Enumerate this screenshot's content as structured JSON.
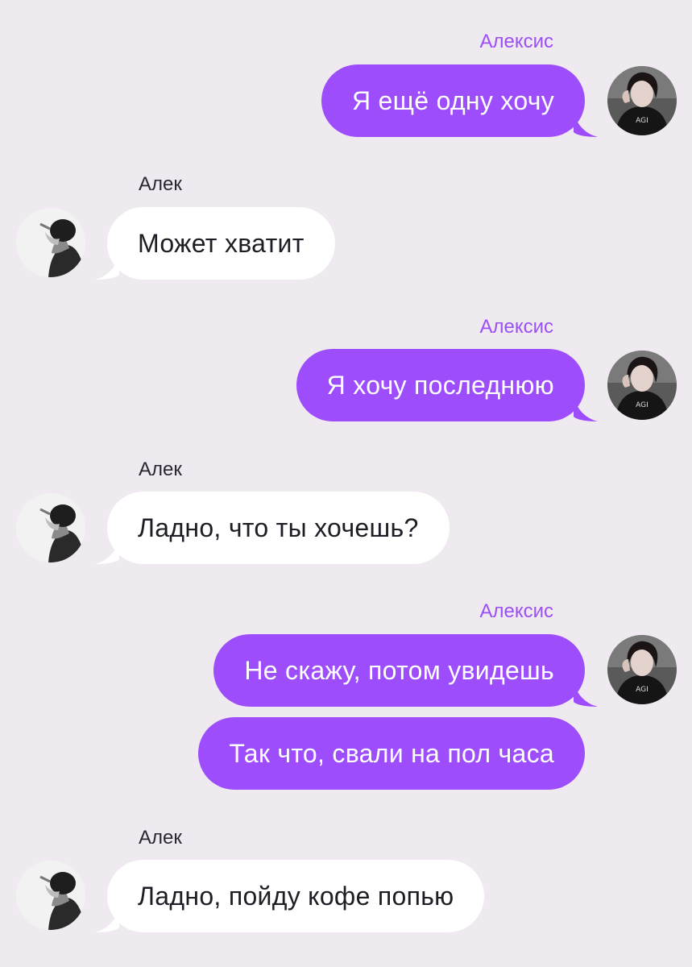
{
  "messages": [
    {
      "sender": "Алексис",
      "text": "Я ещё одну хочу"
    },
    {
      "sender": "Алек",
      "text": "Может хватит"
    },
    {
      "sender": "Алексис",
      "text": "Я хочу последнюю"
    },
    {
      "sender": "Алек",
      "text": "Ладно, что ты хочешь?"
    },
    {
      "sender": "Алексис",
      "text": "Не скажу, потом увидешь"
    },
    {
      "sender": "Алексис",
      "text": "Так что, свали на пол часа"
    },
    {
      "sender": "Алек",
      "text": "Ладно, пойду кофе попью"
    }
  ],
  "colors": {
    "background": "#efeaf0",
    "outgoing_bubble": "#9d4dfb",
    "outgoing_name": "#9b50f5",
    "incoming_bubble": "#ffffff",
    "incoming_name": "#2a2733"
  }
}
